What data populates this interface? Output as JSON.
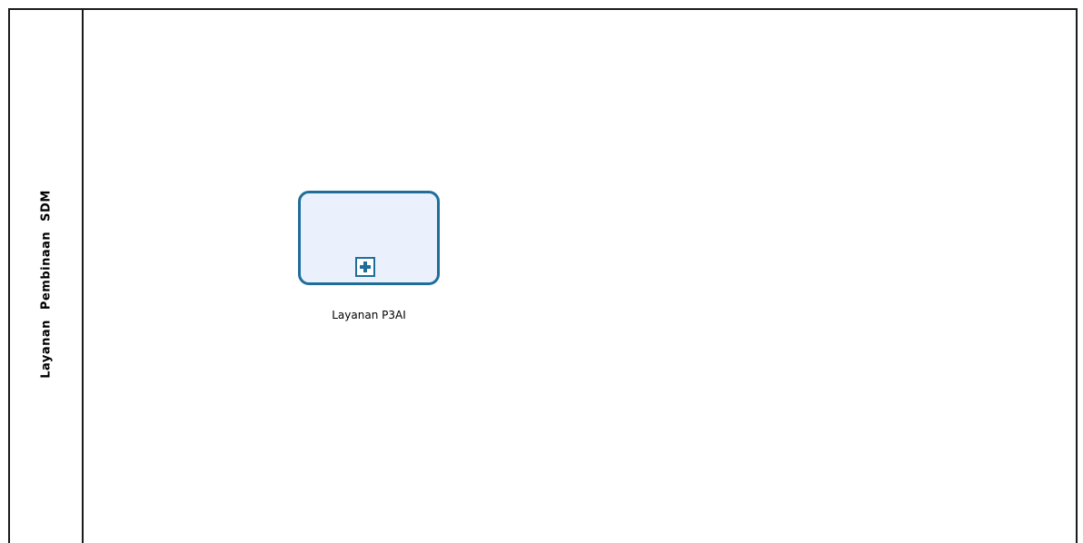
{
  "diagram": {
    "lane": {
      "title": "Layanan Pembinaan SDM"
    },
    "task": {
      "label": "Layanan P3AI",
      "type": "collapsed-subprocess",
      "marker_icon": "plus-icon",
      "fill_color": "#eaf0fc",
      "stroke_color": "#1f6e9a"
    }
  }
}
